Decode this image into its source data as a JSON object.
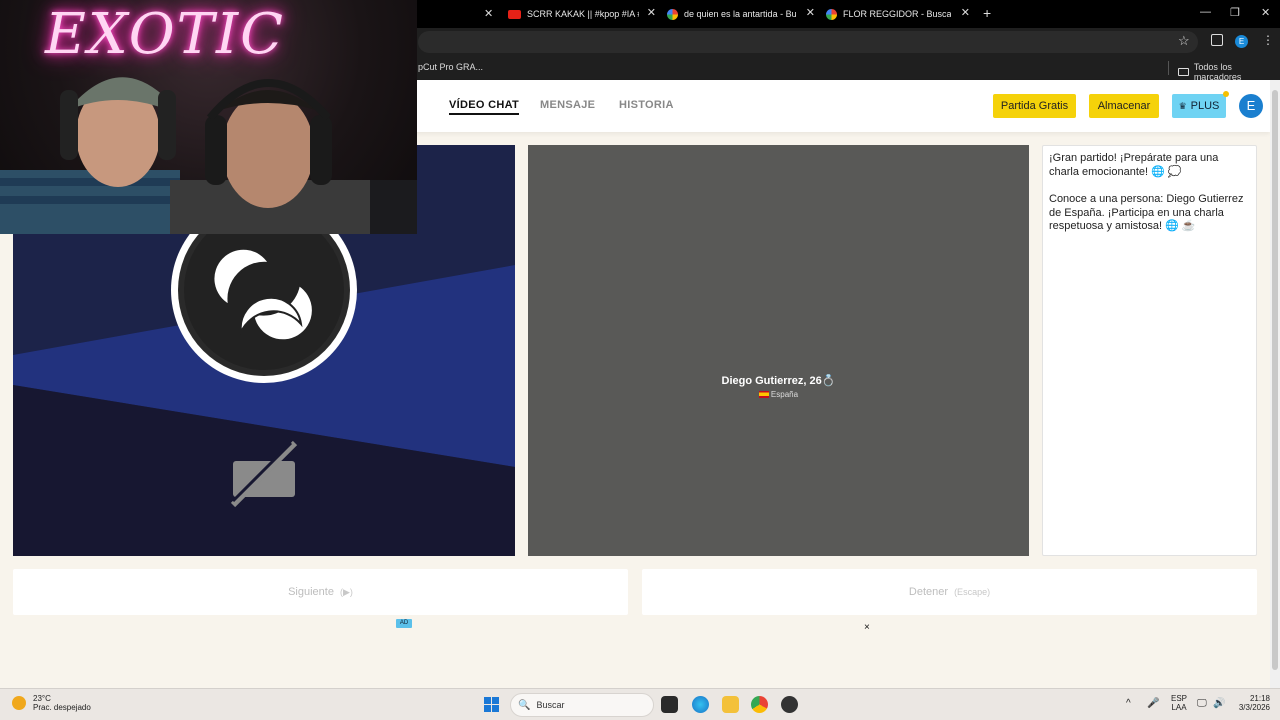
{
  "browser": {
    "tabs": [
      {
        "title": "SCRR KAKAK || #kpop #IA #kats",
        "favicon": "youtube-icon"
      },
      {
        "title": "de quien es la antartida - Busca",
        "favicon": "google-icon"
      },
      {
        "title": "FLOR REGGIDOR - Buscar con G",
        "favicon": "google-icon"
      }
    ],
    "new_tab": "+",
    "bookmarks": {
      "item": "pCut Pro GRA...",
      "all": "Todos los marcadores"
    },
    "profile_initial": "E"
  },
  "overlay": {
    "neon_sign": "EXOTIC"
  },
  "site": {
    "nav": [
      "VÍDEO CHAT",
      "MENSAJE",
      "HISTORIA"
    ],
    "buttons": {
      "free_match": "Partida Gratis",
      "store": "Almacenar",
      "plus": "PLUS"
    },
    "avatar_initial": "E"
  },
  "remote": {
    "name": "Diego Gutierrez, 26",
    "country": "España"
  },
  "chat": {
    "messages": [
      "¡Gran partido! ¡Prepárate para una charla emocionante! 🌐 💭",
      "Conoce a una persona: Diego Gutierrez de España. ¡Participa en una charla respetuosa y amistosa! 🌐 ☕"
    ]
  },
  "controls": {
    "next_label": "Siguiente",
    "next_key": "(▶)",
    "stop_label": "Detener",
    "stop_key": "(Escape)"
  },
  "ad": {
    "badge": "AD",
    "close": "×"
  },
  "taskbar": {
    "weather_temp": "23°C",
    "weather_desc": "Prac. despejado",
    "search_placeholder": "Buscar",
    "lang": "ESP",
    "lang_sub": "LAA",
    "time": "21:18",
    "date": "3/3/2026"
  },
  "colors": {
    "accent_yellow": "#f5d20a",
    "plus_blue": "#6fd3f3",
    "avatar_blue": "#1a7fcf"
  }
}
